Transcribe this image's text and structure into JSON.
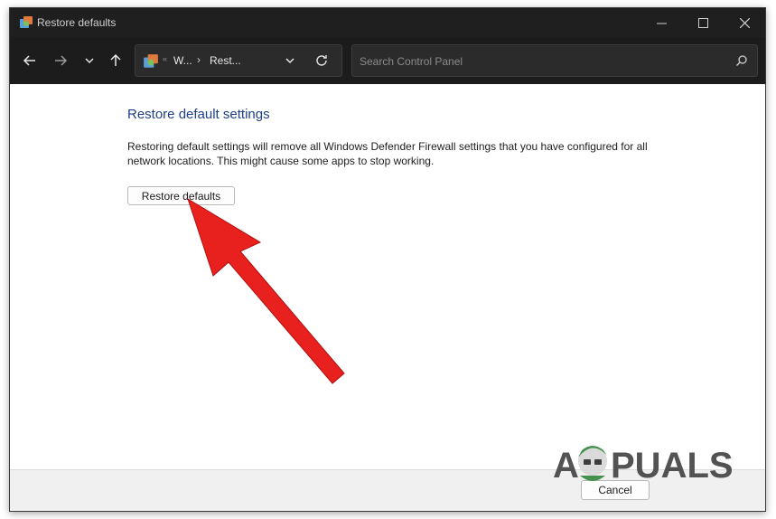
{
  "window": {
    "title": "Restore defaults"
  },
  "navigation": {
    "breadcrumb": [
      "W...",
      "Rest..."
    ],
    "search_placeholder": "Search Control Panel"
  },
  "content": {
    "heading": "Restore default settings",
    "description": "Restoring default settings will remove all Windows Defender Firewall settings that you have configured for all network locations. This might cause some apps to stop working.",
    "restore_button_label": "Restore defaults"
  },
  "footer": {
    "cancel_label": "Cancel"
  },
  "watermark": {
    "text": "APPUALS"
  },
  "colors": {
    "titlebar": "#1f1f1f",
    "heading": "#1e3f87",
    "arrow": "#e8211f"
  }
}
